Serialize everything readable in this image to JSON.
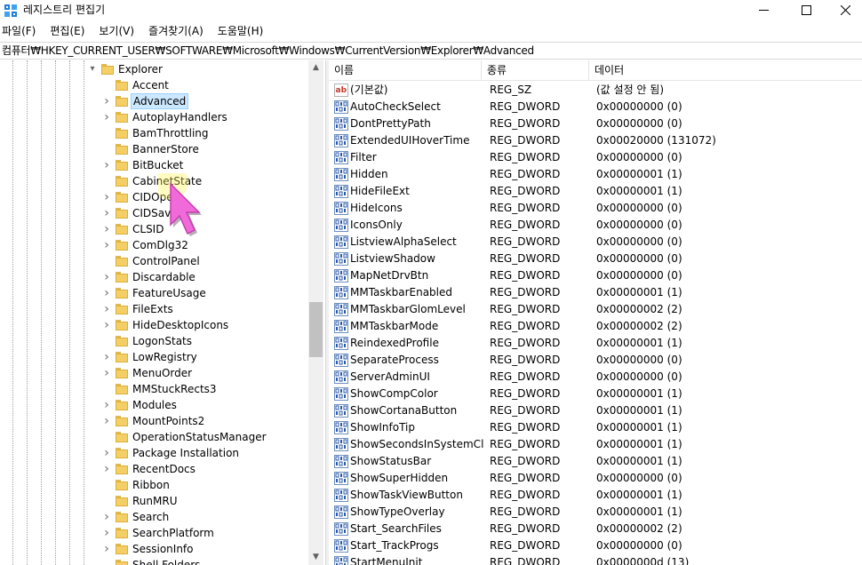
{
  "window": {
    "title": "레지스트리 편집기",
    "minimize_icon": "minimize-icon",
    "maximize_icon": "maximize-icon",
    "close_icon": "close-icon"
  },
  "menu": [
    "파일(F)",
    "편집(E)",
    "보기(V)",
    "즐겨찾기(A)",
    "도움말(H)"
  ],
  "address": "컴퓨터₩HKEY_CURRENT_USER₩SOFTWARE₩Microsoft₩Windows₩CurrentVersion₩Explorer₩Advanced",
  "tree": {
    "parent": "Explorer",
    "selected": "Advanced",
    "items": [
      {
        "label": "Accent",
        "expandable": false
      },
      {
        "label": "Advanced",
        "expandable": true
      },
      {
        "label": "AutoplayHandlers",
        "expandable": true
      },
      {
        "label": "BamThrottling",
        "expandable": false
      },
      {
        "label": "BannerStore",
        "expandable": false
      },
      {
        "label": "BitBucket",
        "expandable": true
      },
      {
        "label": "CabinetState",
        "expandable": false
      },
      {
        "label": "CIDOpen",
        "expandable": true
      },
      {
        "label": "CIDSave",
        "expandable": true
      },
      {
        "label": "CLSID",
        "expandable": true
      },
      {
        "label": "ComDlg32",
        "expandable": true
      },
      {
        "label": "ControlPanel",
        "expandable": false
      },
      {
        "label": "Discardable",
        "expandable": true
      },
      {
        "label": "FeatureUsage",
        "expandable": true
      },
      {
        "label": "FileExts",
        "expandable": true
      },
      {
        "label": "HideDesktopIcons",
        "expandable": true
      },
      {
        "label": "LogonStats",
        "expandable": false
      },
      {
        "label": "LowRegistry",
        "expandable": true
      },
      {
        "label": "MenuOrder",
        "expandable": true
      },
      {
        "label": "MMStuckRects3",
        "expandable": false
      },
      {
        "label": "Modules",
        "expandable": true
      },
      {
        "label": "MountPoints2",
        "expandable": true
      },
      {
        "label": "OperationStatusManager",
        "expandable": false
      },
      {
        "label": "Package Installation",
        "expandable": true
      },
      {
        "label": "RecentDocs",
        "expandable": true
      },
      {
        "label": "Ribbon",
        "expandable": false
      },
      {
        "label": "RunMRU",
        "expandable": false
      },
      {
        "label": "Search",
        "expandable": true
      },
      {
        "label": "SearchPlatform",
        "expandable": true
      },
      {
        "label": "SessionInfo",
        "expandable": true
      },
      {
        "label": "Shell Folders",
        "expandable": false
      }
    ]
  },
  "list": {
    "columns": [
      "이름",
      "종류",
      "데이터"
    ],
    "rows": [
      {
        "icon": "string-value-icon",
        "name": "(기본값)",
        "type": "REG_SZ",
        "data": "(값 설정 안 됨)"
      },
      {
        "icon": "binary-value-icon",
        "name": "AutoCheckSelect",
        "type": "REG_DWORD",
        "data": "0x00000000 (0)"
      },
      {
        "icon": "binary-value-icon",
        "name": "DontPrettyPath",
        "type": "REG_DWORD",
        "data": "0x00000000 (0)"
      },
      {
        "icon": "binary-value-icon",
        "name": "ExtendedUIHoverTime",
        "type": "REG_DWORD",
        "data": "0x00020000 (131072)"
      },
      {
        "icon": "binary-value-icon",
        "name": "Filter",
        "type": "REG_DWORD",
        "data": "0x00000000 (0)"
      },
      {
        "icon": "binary-value-icon",
        "name": "Hidden",
        "type": "REG_DWORD",
        "data": "0x00000001 (1)"
      },
      {
        "icon": "binary-value-icon",
        "name": "HideFileExt",
        "type": "REG_DWORD",
        "data": "0x00000001 (1)"
      },
      {
        "icon": "binary-value-icon",
        "name": "HideIcons",
        "type": "REG_DWORD",
        "data": "0x00000000 (0)"
      },
      {
        "icon": "binary-value-icon",
        "name": "IconsOnly",
        "type": "REG_DWORD",
        "data": "0x00000000 (0)"
      },
      {
        "icon": "binary-value-icon",
        "name": "ListviewAlphaSelect",
        "type": "REG_DWORD",
        "data": "0x00000000 (0)"
      },
      {
        "icon": "binary-value-icon",
        "name": "ListviewShadow",
        "type": "REG_DWORD",
        "data": "0x00000000 (0)"
      },
      {
        "icon": "binary-value-icon",
        "name": "MapNetDrvBtn",
        "type": "REG_DWORD",
        "data": "0x00000000 (0)"
      },
      {
        "icon": "binary-value-icon",
        "name": "MMTaskbarEnabled",
        "type": "REG_DWORD",
        "data": "0x00000001 (1)"
      },
      {
        "icon": "binary-value-icon",
        "name": "MMTaskbarGlomLevel",
        "type": "REG_DWORD",
        "data": "0x00000002 (2)"
      },
      {
        "icon": "binary-value-icon",
        "name": "MMTaskbarMode",
        "type": "REG_DWORD",
        "data": "0x00000002 (2)"
      },
      {
        "icon": "binary-value-icon",
        "name": "ReindexedProfile",
        "type": "REG_DWORD",
        "data": "0x00000001 (1)"
      },
      {
        "icon": "binary-value-icon",
        "name": "SeparateProcess",
        "type": "REG_DWORD",
        "data": "0x00000000 (0)"
      },
      {
        "icon": "binary-value-icon",
        "name": "ServerAdminUI",
        "type": "REG_DWORD",
        "data": "0x00000000 (0)"
      },
      {
        "icon": "binary-value-icon",
        "name": "ShowCompColor",
        "type": "REG_DWORD",
        "data": "0x00000001 (1)"
      },
      {
        "icon": "binary-value-icon",
        "name": "ShowCortanaButton",
        "type": "REG_DWORD",
        "data": "0x00000001 (1)"
      },
      {
        "icon": "binary-value-icon",
        "name": "ShowInfoTip",
        "type": "REG_DWORD",
        "data": "0x00000001 (1)"
      },
      {
        "icon": "binary-value-icon",
        "name": "ShowSecondsInSystemCl...",
        "type": "REG_DWORD",
        "data": "0x00000001 (1)"
      },
      {
        "icon": "binary-value-icon",
        "name": "ShowStatusBar",
        "type": "REG_DWORD",
        "data": "0x00000001 (1)"
      },
      {
        "icon": "binary-value-icon",
        "name": "ShowSuperHidden",
        "type": "REG_DWORD",
        "data": "0x00000000 (0)"
      },
      {
        "icon": "binary-value-icon",
        "name": "ShowTaskViewButton",
        "type": "REG_DWORD",
        "data": "0x00000001 (1)"
      },
      {
        "icon": "binary-value-icon",
        "name": "ShowTypeOverlay",
        "type": "REG_DWORD",
        "data": "0x00000001 (1)"
      },
      {
        "icon": "binary-value-icon",
        "name": "Start_SearchFiles",
        "type": "REG_DWORD",
        "data": "0x00000002 (2)"
      },
      {
        "icon": "binary-value-icon",
        "name": "Start_TrackProgs",
        "type": "REG_DWORD",
        "data": "0x00000000 (0)"
      },
      {
        "icon": "binary-value-icon",
        "name": "StartMenuInit",
        "type": "REG_DWORD",
        "data": "0x0000000d (13)"
      }
    ]
  },
  "colors": {
    "selection_bg": "#cce8ff",
    "selection_border": "#99d1ff",
    "folder": "#f4cf66",
    "cursor": "#f06bd9"
  }
}
